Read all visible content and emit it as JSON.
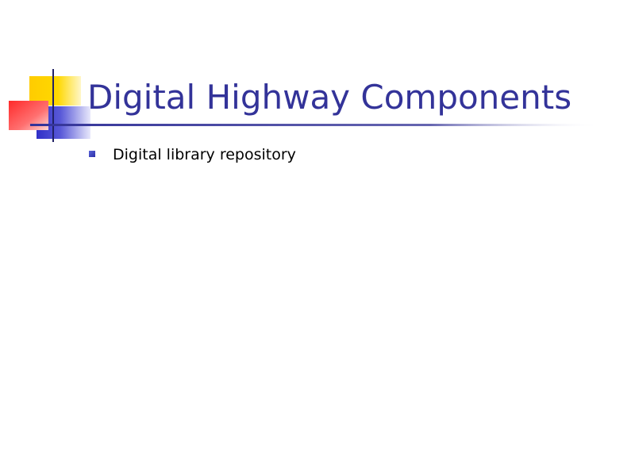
{
  "slide": {
    "title": "Digital Highway Components",
    "bullets": [
      "Digital library repository"
    ]
  },
  "colors": {
    "title": "#333399",
    "bullet": "#3333aa",
    "square_yellow": "#ffcc00",
    "square_red": "#ff3333",
    "square_blue": "#3333cc",
    "rule_line": "#333399"
  }
}
